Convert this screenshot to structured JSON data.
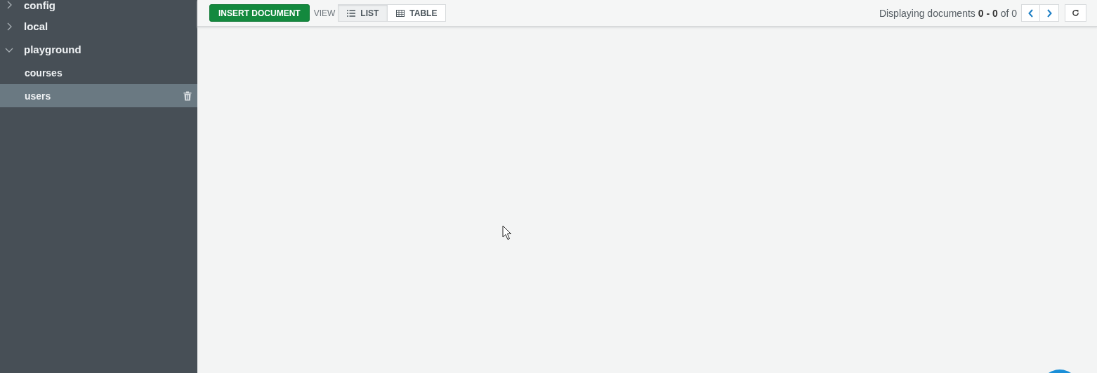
{
  "sidebar": {
    "databases": [
      {
        "name": "config",
        "expanded": false
      },
      {
        "name": "local",
        "expanded": false
      },
      {
        "name": "playground",
        "expanded": true,
        "children": [
          {
            "name": "courses",
            "selected": false
          },
          {
            "name": "users",
            "selected": true
          }
        ]
      }
    ]
  },
  "toolbar": {
    "insert_button": "INSERT DOCUMENT",
    "view_label": "VIEW",
    "views": [
      {
        "label": "LIST",
        "kind": "list",
        "selected": true
      },
      {
        "label": "TABLE",
        "kind": "table",
        "selected": false
      }
    ],
    "pagination": "Displaying documents **0 - 0** of 0"
  }
}
